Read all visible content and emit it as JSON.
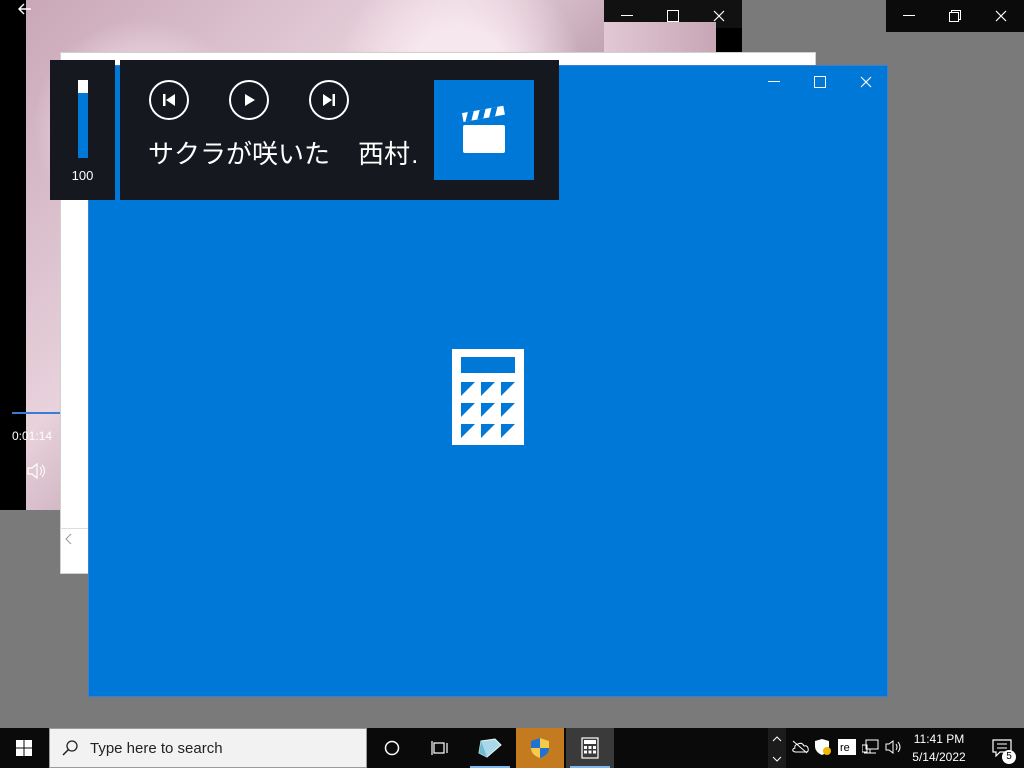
{
  "video_player": {
    "time_elapsed": "0:01:14"
  },
  "media_overlay": {
    "volume": 100,
    "volume_label": "100",
    "track_title": "サクラが咲いた",
    "artist": "西村…"
  },
  "calculator": {
    "state": "splash",
    "accent": "#0078d7",
    "icon": "calculator-icon"
  },
  "taskbar": {
    "search_placeholder": "Type here to search",
    "apps": [
      "cortana-icon",
      "task-view-icon",
      "cube-app-icon",
      "security-shield-icon",
      "calculator-icon"
    ],
    "clock_time": "11:41 PM",
    "clock_date": "5/14/2022",
    "notification_count": "5",
    "tray_icons": [
      "chevron-up-icon",
      "cloud-off-icon",
      "security-icon",
      "re-icon",
      "network-icon",
      "volume-icon"
    ]
  }
}
